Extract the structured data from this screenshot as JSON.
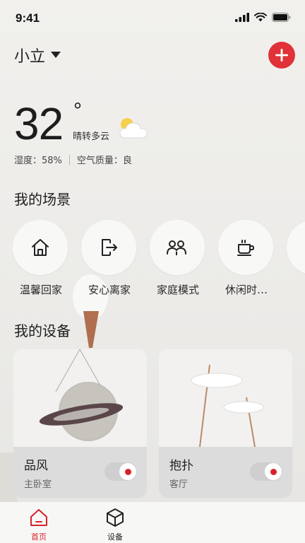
{
  "status_bar": {
    "time": "9:41"
  },
  "header": {
    "home_name": "小立"
  },
  "weather": {
    "temperature": "32",
    "degree_symbol": "°",
    "condition": "晴转多云",
    "humidity": "湿度：58%",
    "air_quality": "空气质量：良"
  },
  "scenes": {
    "title": "我的场景",
    "items": [
      {
        "label": "温馨回家",
        "icon": "home-icon"
      },
      {
        "label": "安心离家",
        "icon": "exit-icon"
      },
      {
        "label": "家庭模式",
        "icon": "family-icon"
      },
      {
        "label": "休闲时…",
        "icon": "coffee-icon"
      }
    ]
  },
  "devices": {
    "title": "我的设备",
    "items": [
      {
        "name": "品风",
        "room": "主卧室",
        "on": true
      },
      {
        "name": "抱扑",
        "room": "客厅",
        "on": true
      }
    ]
  },
  "tabbar": {
    "items": [
      {
        "label": "首页",
        "active": true,
        "icon": "home-tab-icon"
      },
      {
        "label": "设备",
        "active": false,
        "icon": "device-cube-icon"
      }
    ]
  },
  "colors": {
    "accent": "#e03238",
    "active_tab": "#d6232b"
  }
}
